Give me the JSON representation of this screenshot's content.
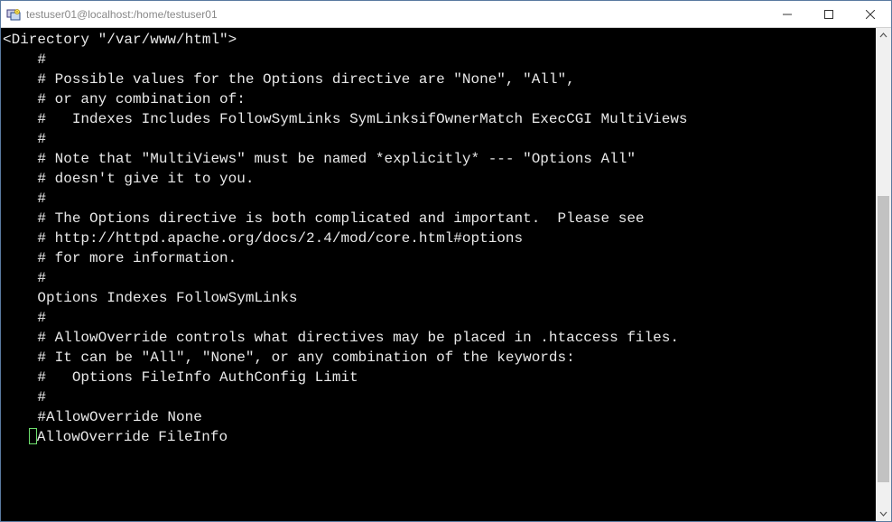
{
  "window": {
    "title": "testuser01@localhost:/home/testuser01"
  },
  "terminal": {
    "lines": [
      "<Directory \"/var/www/html\">",
      "    #",
      "    # Possible values for the Options directive are \"None\", \"All\",",
      "    # or any combination of:",
      "    #   Indexes Includes FollowSymLinks SymLinksifOwnerMatch ExecCGI MultiViews",
      "    #",
      "    # Note that \"MultiViews\" must be named *explicitly* --- \"Options All\"",
      "    # doesn't give it to you.",
      "    #",
      "    # The Options directive is both complicated and important.  Please see",
      "    # http://httpd.apache.org/docs/2.4/mod/core.html#options",
      "    # for more information.",
      "    #",
      "    Options Indexes FollowSymLinks",
      "",
      "    #",
      "    # AllowOverride controls what directives may be placed in .htaccess files.",
      "    # It can be \"All\", \"None\", or any combination of the keywords:",
      "    #   Options FileInfo AuthConfig Limit",
      "    #",
      "    #AllowOverride None",
      "    AllowOverride FileInfo"
    ],
    "cursor_line_prefix": "   ",
    "cursor_line_suffix": "AllowOverride FileInfo"
  }
}
